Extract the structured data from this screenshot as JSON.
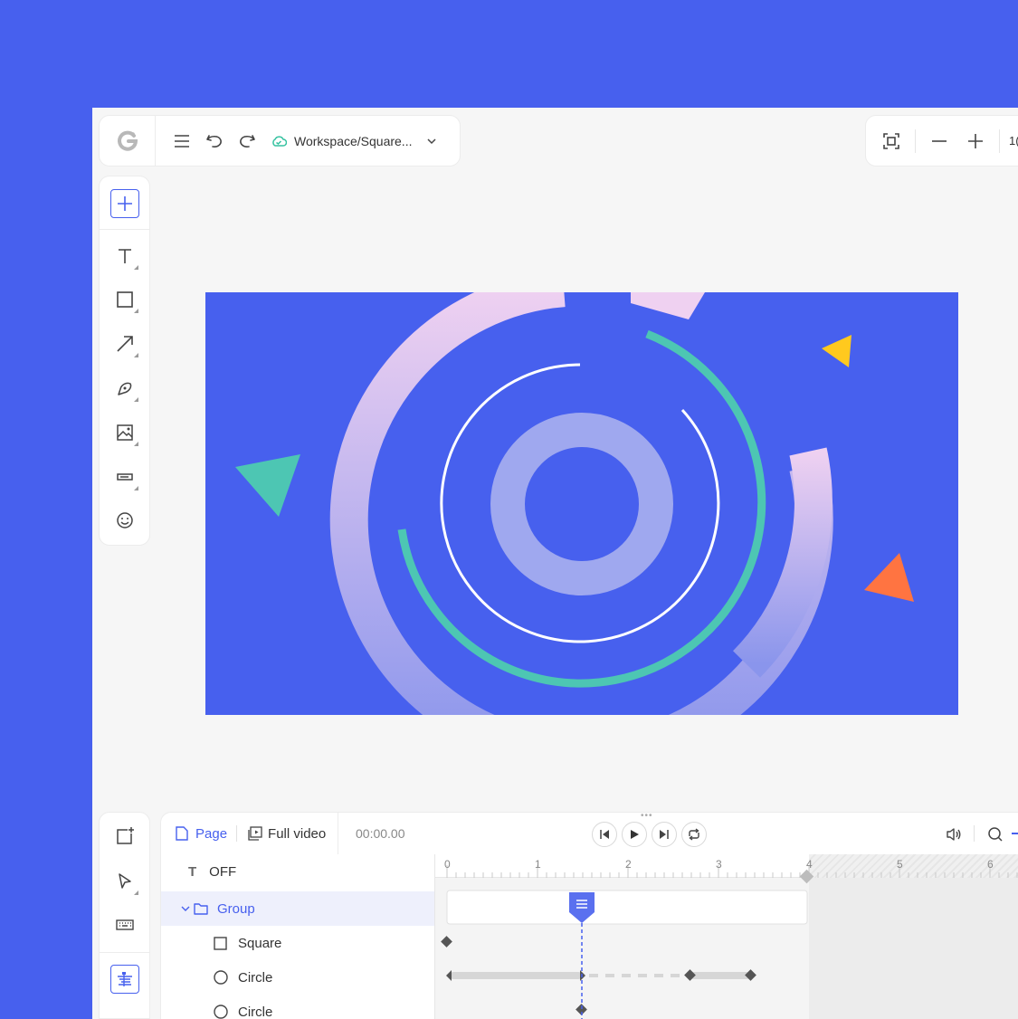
{
  "topbar": {
    "breadcrumb": "Workspace/Square..."
  },
  "rightbar": {
    "zoom_partial": "1("
  },
  "timeline": {
    "tab_page": "Page",
    "tab_full_video": "Full video",
    "current_time": "00:00.00",
    "ruler_ticks": [
      "0",
      "1",
      "2",
      "3",
      "4",
      "5",
      "6"
    ]
  },
  "layers": [
    {
      "label": "OFF",
      "type": "text"
    },
    {
      "label": "Group",
      "type": "group"
    },
    {
      "label": "Square",
      "type": "square"
    },
    {
      "label": "Circle",
      "type": "circle"
    },
    {
      "label": "Circle",
      "type": "circle"
    }
  ],
  "colors": {
    "brand": "#4760EE",
    "accent_green": "#4DC6B3",
    "accent_yellow": "#FFC91E",
    "accent_orange": "#FF7441",
    "accent_pink": "#F0D0F0"
  }
}
